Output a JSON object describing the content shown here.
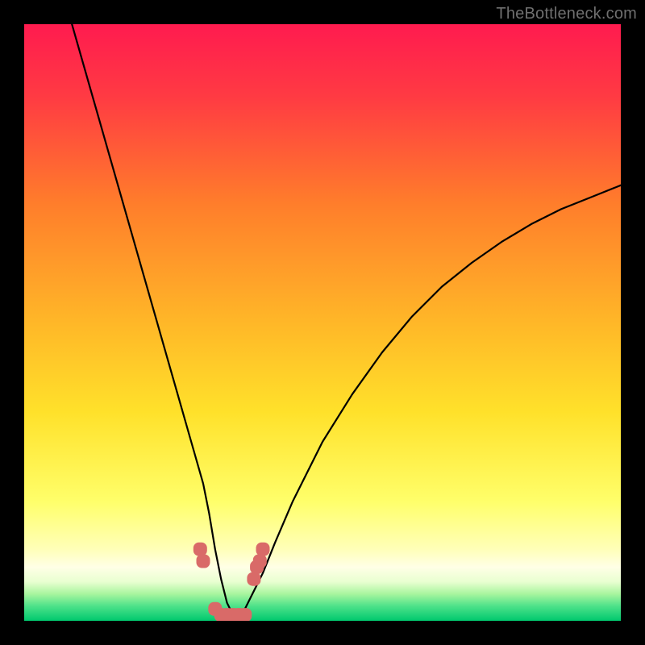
{
  "watermark": "TheBottleneck.com",
  "colors": {
    "frame": "#000000",
    "gradient_top": "#ff1b4f",
    "gradient_mid_upper": "#ff7d2b",
    "gradient_mid": "#ffd52a",
    "gradient_lower": "#ffff6a",
    "gradient_pale": "#ffffe0",
    "gradient_green": "#00e676",
    "curve": "#000000",
    "markers": "#d96a68"
  },
  "chart_data": {
    "type": "line",
    "title": "",
    "xlabel": "",
    "ylabel": "",
    "xlim": [
      0,
      100
    ],
    "ylim": [
      0,
      100
    ],
    "series": [
      {
        "name": "bottleneck-curve",
        "x": [
          8,
          10,
          12,
          14,
          16,
          18,
          20,
          22,
          24,
          26,
          28,
          30,
          31,
          32,
          33,
          34,
          35,
          36,
          37,
          38,
          40,
          42,
          45,
          50,
          55,
          60,
          65,
          70,
          75,
          80,
          85,
          90,
          95,
          100
        ],
        "values": [
          100,
          93,
          86,
          79,
          72,
          65,
          58,
          51,
          44,
          37,
          30,
          23,
          18,
          12,
          7,
          3,
          1,
          1,
          2,
          4,
          8,
          13,
          20,
          30,
          38,
          45,
          51,
          56,
          60,
          63.5,
          66.5,
          69,
          71,
          73
        ]
      }
    ],
    "markers": {
      "name": "highlight-points",
      "x": [
        29.5,
        30,
        32,
        33,
        34,
        35,
        36,
        37,
        38.5,
        39,
        39.5,
        40
      ],
      "y": [
        12,
        10,
        2,
        1,
        1,
        1,
        1,
        1,
        7,
        9,
        10,
        12
      ]
    },
    "annotations": []
  }
}
